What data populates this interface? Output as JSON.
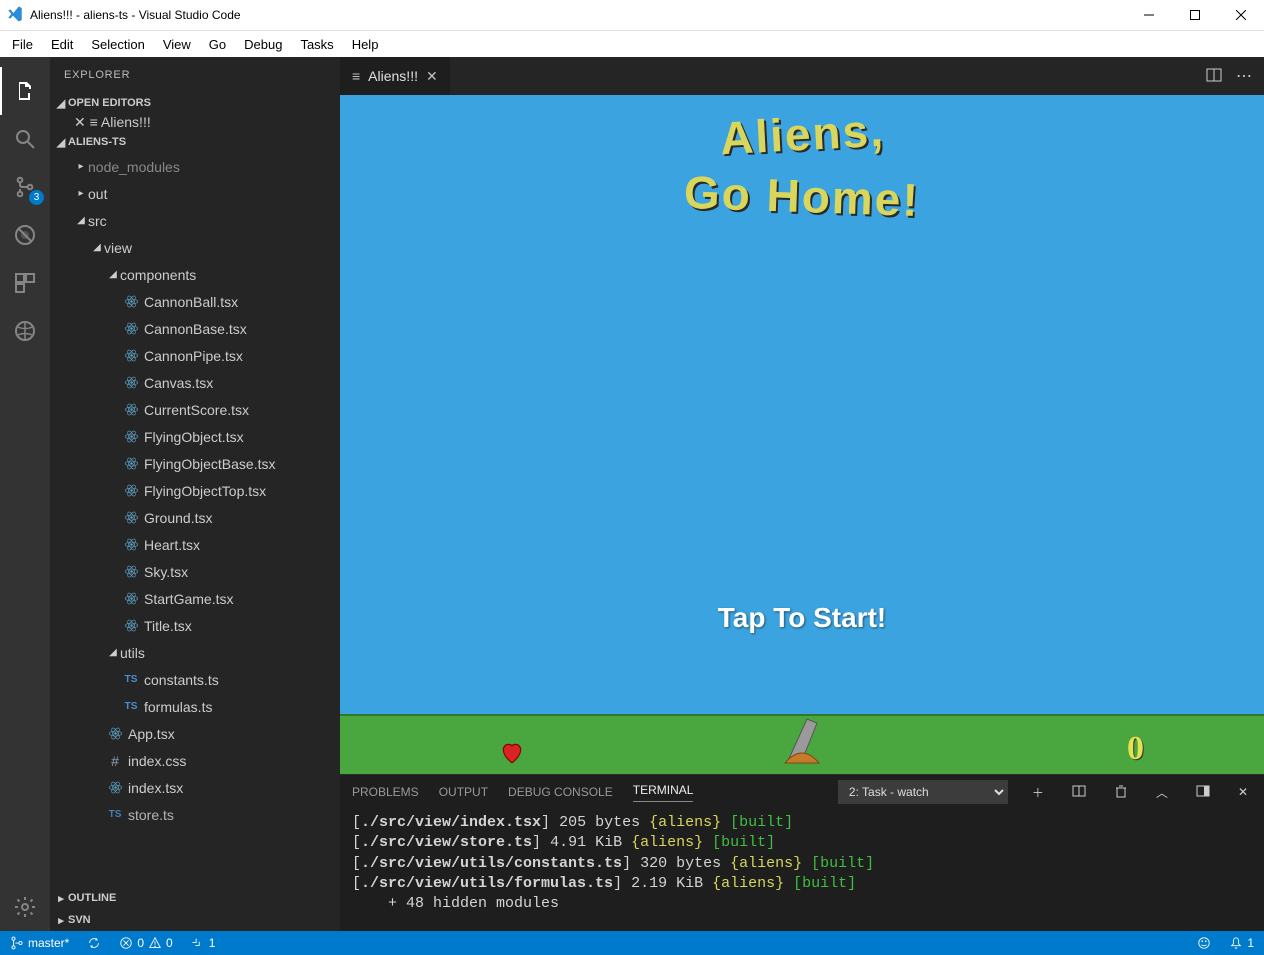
{
  "window": {
    "title": "Aliens!!! - aliens-ts - Visual Studio Code"
  },
  "menu": [
    "File",
    "Edit",
    "Selection",
    "View",
    "Go",
    "Debug",
    "Tasks",
    "Help"
  ],
  "activity": {
    "scm_badge": "3"
  },
  "sidebar": {
    "header": "EXPLORER",
    "sections": {
      "open_editors": "OPEN EDITORS",
      "project": "ALIENS-TS",
      "outline": "OUTLINE",
      "svn": "SVN"
    },
    "open_editor_item": "Aliens!!!",
    "tree": {
      "node_modules": "node_modules",
      "out": "out",
      "src": "src",
      "view": "view",
      "components": "components",
      "files": {
        "CannonBall": "CannonBall.tsx",
        "CannonBase": "CannonBase.tsx",
        "CannonPipe": "CannonPipe.tsx",
        "Canvas": "Canvas.tsx",
        "CurrentScore": "CurrentScore.tsx",
        "FlyingObject": "FlyingObject.tsx",
        "FlyingObjectBase": "FlyingObjectBase.tsx",
        "FlyingObjectTop": "FlyingObjectTop.tsx",
        "Ground": "Ground.tsx",
        "Heart": "Heart.tsx",
        "Sky": "Sky.tsx",
        "StartGame": "StartGame.tsx",
        "Title": "Title.tsx"
      },
      "utils": "utils",
      "constants": "constants.ts",
      "formulas": "formulas.ts",
      "App": "App.tsx",
      "indexcss": "index.css",
      "indextsx": "index.tsx",
      "storets": "store.ts"
    }
  },
  "editor": {
    "tab_title": "Aliens!!!"
  },
  "game": {
    "title_line1": "Aliens,",
    "title_line2": "Go Home!",
    "tap": "Tap To Start!",
    "score": "0"
  },
  "panel": {
    "tabs": {
      "problems": "PROBLEMS",
      "output": "OUTPUT",
      "debug": "DEBUG CONSOLE",
      "terminal": "TERMINAL"
    },
    "task_selected": "2: Task - watch",
    "lines": [
      {
        "path": "./src/view/index.tsx",
        "rest": " 205 bytes ",
        "mod": "{aliens}",
        "status": "[built]"
      },
      {
        "path": "./src/view/store.ts",
        "rest": " 4.91 KiB ",
        "mod": "{aliens}",
        "status": "[built]"
      },
      {
        "path": "./src/view/utils/constants.ts",
        "rest": " 320 bytes ",
        "mod": "{aliens}",
        "status": "[built]"
      },
      {
        "path": "./src/view/utils/formulas.ts",
        "rest": " 2.19 KiB ",
        "mod": "{aliens}",
        "status": "[built]"
      }
    ],
    "hidden": "    + 48 hidden modules"
  },
  "status": {
    "branch": "master*",
    "errors": "0",
    "warnings": "0",
    "last": "1",
    "bell": "1"
  }
}
